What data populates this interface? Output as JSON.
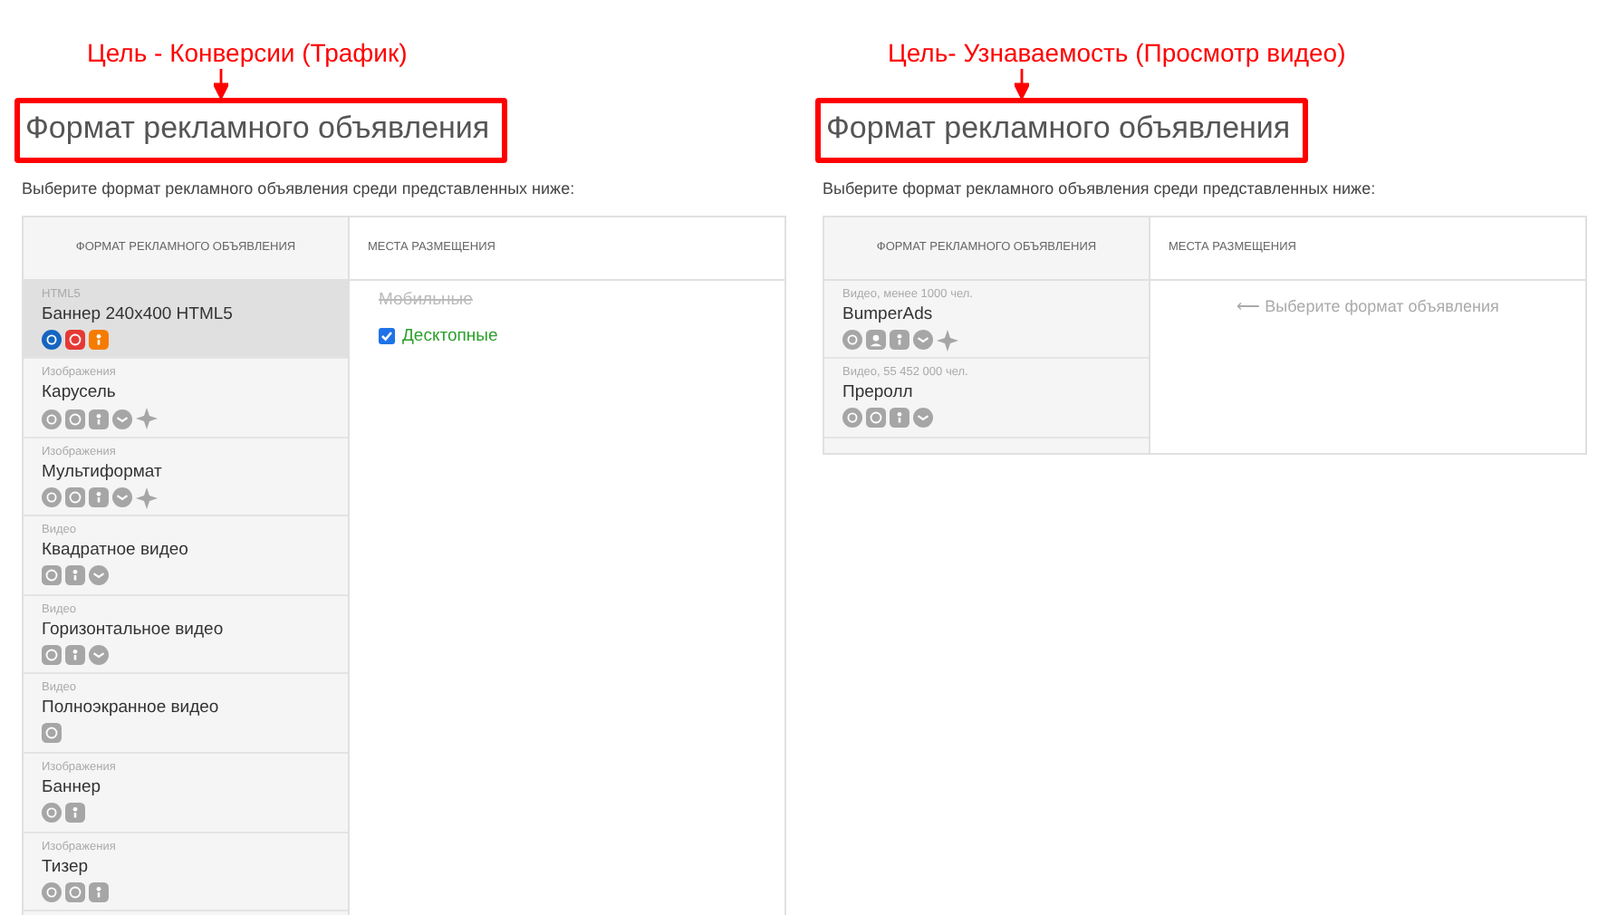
{
  "panels": [
    {
      "goal": "Цель - Конверсии (Трафик)",
      "heading": "Формат рекламного объявления",
      "subtitle": "Выберите формат рекламного объявления среди представленных ниже:",
      "columns": [
        "ФОРМАТ РЕКЛАМНОГО ОБЪЯВЛЕНИЯ",
        "МЕСТА РАЗМЕЩЕНИЯ"
      ],
      "formats": [
        {
          "category": "HTML5",
          "name": "Баннер 240x400 HTML5",
          "selected": true,
          "icons": [
            {
              "kind": "mail"
            },
            {
              "kind": "target"
            },
            {
              "kind": "ok"
            }
          ]
        },
        {
          "category": "Изображения",
          "name": "Карусель",
          "selected": false,
          "icons": [
            {
              "kind": "mail"
            },
            {
              "kind": "target"
            },
            {
              "kind": "ok"
            },
            {
              "kind": "vk"
            },
            {
              "kind": "star"
            }
          ]
        },
        {
          "category": "Изображения",
          "name": "Мультиформат",
          "selected": false,
          "icons": [
            {
              "kind": "mail"
            },
            {
              "kind": "target"
            },
            {
              "kind": "ok"
            },
            {
              "kind": "vk"
            },
            {
              "kind": "star"
            }
          ]
        },
        {
          "category": "Видео",
          "name": "Квадратное видео",
          "selected": false,
          "icons": [
            {
              "kind": "target"
            },
            {
              "kind": "ok"
            },
            {
              "kind": "vk"
            }
          ]
        },
        {
          "category": "Видео",
          "name": "Горизонтальное видео",
          "selected": false,
          "icons": [
            {
              "kind": "target"
            },
            {
              "kind": "ok"
            },
            {
              "kind": "vk"
            }
          ]
        },
        {
          "category": "Видео",
          "name": "Полноэкранное видео",
          "selected": false,
          "icons": [
            {
              "kind": "target"
            }
          ]
        },
        {
          "category": "Изображения",
          "name": "Баннер",
          "selected": false,
          "icons": [
            {
              "kind": "mail"
            },
            {
              "kind": "ok"
            }
          ]
        },
        {
          "category": "Изображения",
          "name": "Тизер",
          "selected": false,
          "icons": [
            {
              "kind": "mail"
            },
            {
              "kind": "target"
            },
            {
              "kind": "ok"
            }
          ]
        }
      ],
      "placements": [
        {
          "label": "Мобильные",
          "disabled": true
        },
        {
          "label": "Десктопные",
          "disabled": false,
          "checked": true
        }
      ]
    },
    {
      "goal": "Цель- Узнаваемость (Просмотр видео)",
      "heading": "Формат рекламного объявления",
      "subtitle": "Выберите формат рекламного объявления среди представленных ниже:",
      "columns": [
        "ФОРМАТ РЕКЛАМНОГО ОБЪЯВЛЕНИЯ",
        "МЕСТА РАЗМЕЩЕНИЯ"
      ],
      "formats": [
        {
          "category": "Видео, менее 1000 чел.",
          "name": "BumperAds",
          "selected": false,
          "icons": [
            {
              "kind": "mail"
            },
            {
              "kind": "people"
            },
            {
              "kind": "ok"
            },
            {
              "kind": "vk"
            },
            {
              "kind": "star"
            }
          ]
        },
        {
          "category": "Видео, 55 452 000 чел.",
          "name": "Преролл",
          "selected": false,
          "icons": [
            {
              "kind": "mail"
            },
            {
              "kind": "target"
            },
            {
              "kind": "ok"
            },
            {
              "kind": "vk"
            }
          ]
        }
      ],
      "hint": "⟵ Выберите формат объявления"
    }
  ]
}
